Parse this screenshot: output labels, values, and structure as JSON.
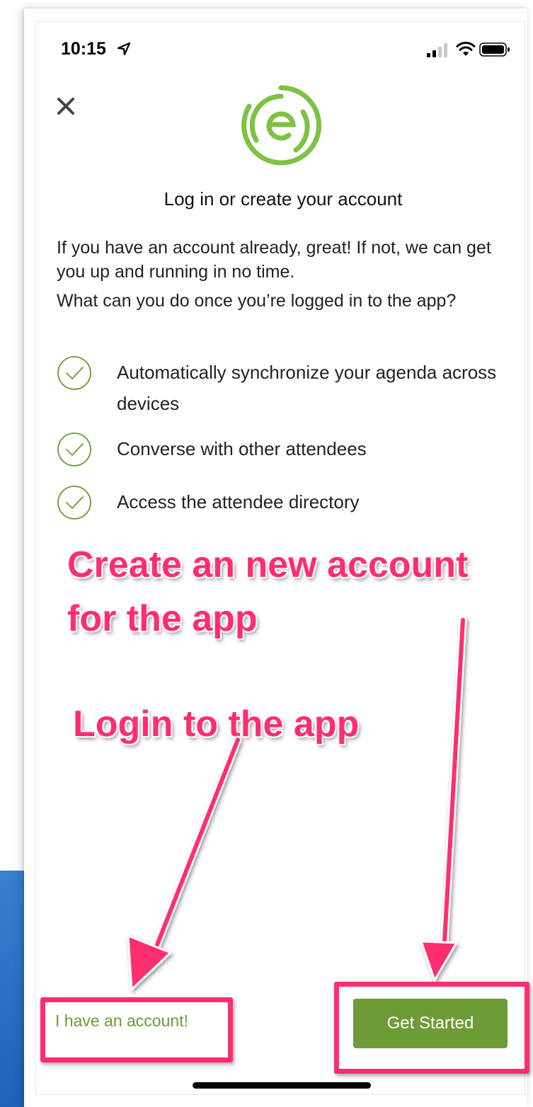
{
  "status_bar": {
    "time": "10:15"
  },
  "icons": {
    "location": "location-arrow-icon",
    "signal": "cellular-signal-icon",
    "wifi": "wifi-icon",
    "battery": "battery-icon",
    "close": "close-icon",
    "logo": "eventbase-e-logo",
    "check": "checkmark-circle-icon"
  },
  "colors": {
    "brand_green": "#6d9b37",
    "logo_green": "#7dc242",
    "annotation_pink": "#ff2d6e"
  },
  "content": {
    "title": "Log in or create your account",
    "paragraph_1": "If you have an account already, great! If not, we can get you up and running in no time.",
    "paragraph_2": "What can you do once you’re logged in to the app?",
    "features": [
      "Automatically synchronize your agenda across devices",
      "Converse with other attendees",
      "Access the attendee directory"
    ]
  },
  "annotations": {
    "create_account": "Create an new account for the app",
    "login": "Login to the app"
  },
  "buttons": {
    "have_account": "I have an account!",
    "get_started": "Get Started"
  }
}
